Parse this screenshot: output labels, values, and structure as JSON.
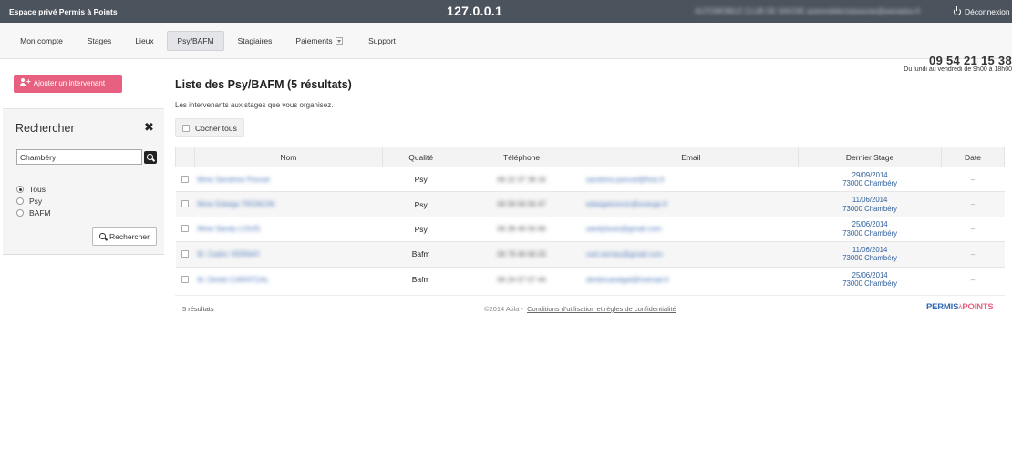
{
  "topbar": {
    "brand": "Espace privé Permis à Points",
    "host": "127.0.0.1",
    "account": "AUTOMOBILE CLUB DE SAVOIE automobileclubsavoie@wanadoo.fr",
    "logout": "Déconnexion"
  },
  "nav": {
    "items": [
      "Mon compte",
      "Stages",
      "Lieux",
      "Psy/BAFM",
      "Stagiaires",
      "Paiements",
      "Support"
    ],
    "active": "Psy/BAFM",
    "phone": "09 54 21 15 38",
    "hours": "Du lundi au vendredi de 9h00 à 18h00"
  },
  "sidebar": {
    "add_button": "Ajouter un intervenant",
    "search_title": "Rechercher",
    "search_value": "Chambéry",
    "radios": [
      "Tous",
      "Psy",
      "BAFM"
    ],
    "radio_selected": "Tous",
    "search_button": "Rechercher"
  },
  "main": {
    "title": "Liste des Psy/BAFM (5 résultats)",
    "subtitle": "Les intervenants aux stages que vous organisez.",
    "check_all": "Cocher tous",
    "columns": [
      "Nom",
      "Qualité",
      "Téléphone",
      "Email",
      "Dernier Stage",
      "Date"
    ],
    "rows": [
      {
        "nom": "Mme Sandrine Poncet",
        "qualite": "Psy",
        "tel": "06 22 37 38 16",
        "email": "sandrine.poncet@free.fr",
        "stage_date": "29/09/2014",
        "stage_place": "73000 Chambéry",
        "date": "–"
      },
      {
        "nom": "Mme Edwige TRONCIN",
        "qualite": "Psy",
        "tel": "06 59 56 56 47",
        "email": "edwigetroncin@orange.fr",
        "stage_date": "11/06/2014",
        "stage_place": "73000 Chambéry",
        "date": "–"
      },
      {
        "nom": "Mme Sandy LOUIS",
        "qualite": "Psy",
        "tel": "06 38 46 56 66",
        "email": "sandylouis@gmail.com",
        "stage_date": "25/06/2014",
        "stage_place": "73000 Chambéry",
        "date": "–"
      },
      {
        "nom": "M. Cedric VERNAY",
        "qualite": "Bafm",
        "tel": "06 79 46 66 03",
        "email": "ced.vernay@gmail.com",
        "stage_date": "11/06/2014",
        "stage_place": "73000 Chambéry",
        "date": "–"
      },
      {
        "nom": "M. Dimitri CARATGAL",
        "qualite": "Bafm",
        "tel": "06 24 07 07 44",
        "email": "dimitricaratgal@hotmail.fr",
        "stage_date": "25/06/2014",
        "stage_place": "73000 Chambéry",
        "date": "–"
      }
    ]
  },
  "footer": {
    "count": "5 résultats",
    "copyright": "©2014 Atila -",
    "terms_link": "Conditions d'utilisation et règles de confidentialité",
    "logo_part1": "PERMIS",
    "logo_part2": "À",
    "logo_part3": "POINTS"
  },
  "colors": {
    "topbar": "#4b535d",
    "accent_pink": "#e8607f",
    "link_blue": "#2e5f9a"
  }
}
